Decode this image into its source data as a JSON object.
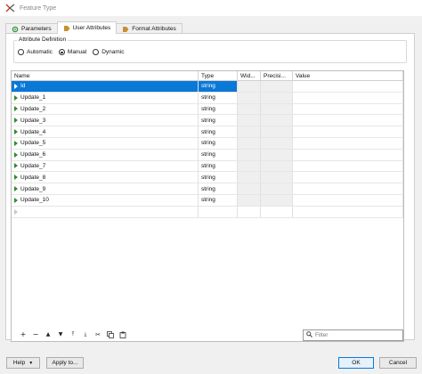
{
  "window": {
    "title": "Feature Type"
  },
  "tabs": [
    {
      "label": "Parameters",
      "icon": "gear-icon"
    },
    {
      "label": "User Attributes",
      "icon": "tag-icon"
    },
    {
      "label": "Format Attributes",
      "icon": "tag-icon"
    }
  ],
  "active_tab": "User Attributes",
  "attribute_definition": {
    "label": "Attribute Definition",
    "options": [
      "Automatic",
      "Manual",
      "Dynamic"
    ],
    "selected": "Manual"
  },
  "table": {
    "columns": [
      "Name",
      "Type",
      "Wid...",
      "Precisi...",
      "Value"
    ],
    "rows": [
      {
        "name": "Id",
        "type": "string",
        "selected": true
      },
      {
        "name": "Update_1",
        "type": "string"
      },
      {
        "name": "Update_2",
        "type": "string"
      },
      {
        "name": "Update_3",
        "type": "string"
      },
      {
        "name": "Update_4",
        "type": "string"
      },
      {
        "name": "Update_5",
        "type": "string"
      },
      {
        "name": "Update_6",
        "type": "string"
      },
      {
        "name": "Update_7",
        "type": "string"
      },
      {
        "name": "Update_8",
        "type": "string"
      },
      {
        "name": "Update_9",
        "type": "string"
      },
      {
        "name": "Update_10",
        "type": "string"
      }
    ]
  },
  "toolbar": {
    "icons": [
      "add-icon",
      "remove-icon",
      "move-up-icon",
      "move-down-icon",
      "move-top-icon",
      "move-bottom-icon",
      "cut-icon",
      "copy-icon",
      "paste-icon"
    ]
  },
  "filter": {
    "placeholder": "Filter",
    "value": ""
  },
  "buttons": {
    "help": "Help",
    "apply": "Apply to...",
    "ok": "OK",
    "cancel": "Cancel"
  },
  "colors": {
    "selection": "#0a78d7",
    "row_marker": "#2e8b2e"
  }
}
